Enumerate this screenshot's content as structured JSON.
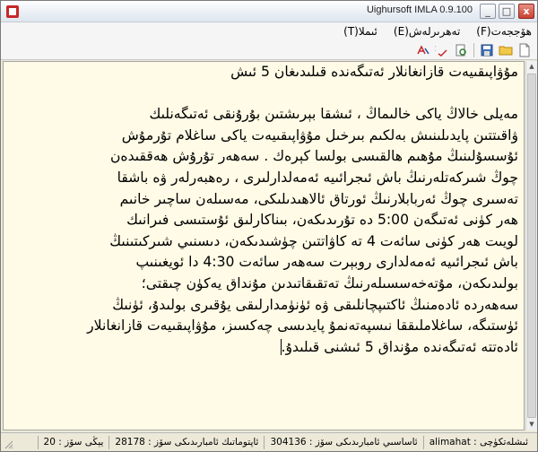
{
  "window": {
    "title": "Uighursoft IMLA 0.9.100",
    "min_symbol": "_",
    "max_symbol": "□",
    "close_symbol": "x"
  },
  "menu": {
    "items": [
      {
        "label": "ھۆججەت(F)"
      },
      {
        "label": "تەھرىرلەش(E)"
      },
      {
        "label": "ئىملا(T)"
      }
    ]
  },
  "toolbar": {
    "tools": [
      "new-file-icon",
      "open-folder-icon",
      "save-icon",
      "print-preview-icon",
      "spell-check-icon",
      "auto-correct-icon"
    ]
  },
  "editor": {
    "lines": [
      "مۇۋاپىقىيەت قازانغانلار ئەتىگەندە قىلىدىغان 5 ئىش",
      "",
      "مەيلى خالاڭ ياكى خالىماڭ ، ئىشقا بېرىشتىن بۇرۇنقى ئەتىگەنلىك",
      "ۋاقىتتىن پايدىلىنىش بەلكىم بىرخىل مۇۋاپىقىيەت ياكى ساغلام تۇرمۇش",
      "ئۇسسۇلىنىڭ مۇھىم ھالقىسى بولسا كېرەك . سەھەر تۇرۇش ھەققىدەن",
      "چوڭ شىركەتلەرنىڭ باش ئىجرائىيە ئەمەلدارلىرى ، رەھبەرلەر ۋە باشقا",
      "تەسىرى چوڭ ئەربابلارنىڭ ئورتاق ئالاھىدىلىكى، مەسىلەن ساچىر خانىم",
      "ھەر كۈنى ئەتىگەن 5:00 دە تۇرىدىكەن، بىناكارلىق ئۇستىسى فىرانىك",
      "لويىت ھەر كۈنى سائەت 4 تە كاۋاتتىن چۈشىدىكەن، دىسنىي شىركىتىنىڭ",
      "باش ئىجرائىيە ئەمەلدارى روبېرت سەھەر سائەت 4:30 دا ئويغىنىپ",
      "بولىدىكەن، مۇتەخەسسىلەرنىڭ تەتقىقاتىدىن مۇنداق يەكۈن چىقتى؛",
      "سەھەردە ئادەمنىڭ ئاكتىپچانلىقى ۋە ئۈنۈمدارلىقى يۇقىرى بولىدۇ، ئۈنىڭ",
      "ئۈستىگە، ساغلاملىققا نىسپەتەنمۇ پايدىسى چەكسىز، مۇۋاپىقىيەت قازانغانلار",
      "ئادەتتە ئەتىگەندە مۇنداق 5 ئىشنى قىلىدۇ."
    ]
  },
  "status": {
    "user": "ئىشلەتكۈچى : alimahat",
    "basic_words": "ئاساسىي ئامبارىدىكى سۆز : 304136",
    "extended_words": "ئاپتوماتىك ئامبارىدىكى سۆز : 28178",
    "new_words": "يېڭى سۆز : 20"
  },
  "colors": {
    "editor_background": "#fffbe6",
    "chrome_background": "#ece9d8"
  }
}
